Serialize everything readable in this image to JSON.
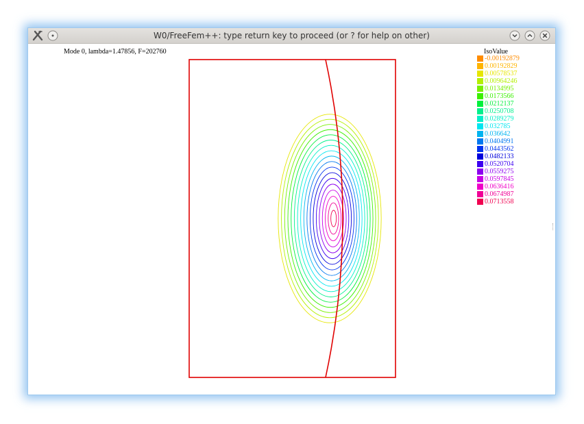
{
  "window": {
    "title": "W0/FreeFem++: type return key to proceed (or ? for help on other)"
  },
  "titlebar": {
    "icons": {
      "app": "freefem-app-icon",
      "menu": "window-menu-icon",
      "minimize": "minimize-icon",
      "maximize": "maximize-icon",
      "close": "close-icon"
    }
  },
  "plot": {
    "label": "Mode 0, lambda=1.47856, F=202760",
    "frame_color": "#e00000"
  },
  "legend": {
    "title": "IsoValue",
    "items": [
      {
        "label": "-0.00192879",
        "color": "#ff8c00"
      },
      {
        "label": "0.00192829",
        "color": "#ffb400"
      },
      {
        "label": "0.00578537",
        "color": "#e6e600"
      },
      {
        "label": "0.00964246",
        "color": "#b4f000"
      },
      {
        "label": "0.0134995",
        "color": "#78f000"
      },
      {
        "label": "0.0173566",
        "color": "#3cf000"
      },
      {
        "label": "0.0212137",
        "color": "#00f03c"
      },
      {
        "label": "0.0250708",
        "color": "#00f08c"
      },
      {
        "label": "0.0289279",
        "color": "#00f0c8"
      },
      {
        "label": "0.032785",
        "color": "#00e6f0"
      },
      {
        "label": "0.036642",
        "color": "#00b4f0"
      },
      {
        "label": "0.0404991",
        "color": "#0078f0"
      },
      {
        "label": "0.0443562",
        "color": "#0032f0"
      },
      {
        "label": "0.0482133",
        "color": "#0000dc"
      },
      {
        "label": "0.0520704",
        "color": "#3c00f0"
      },
      {
        "label": "0.0559275",
        "color": "#8c00f0"
      },
      {
        "label": "0.0597845",
        "color": "#c800e6"
      },
      {
        "label": "0.0636416",
        "color": "#f000c8"
      },
      {
        "label": "0.0674987",
        "color": "#f00096"
      },
      {
        "label": "0.0713558",
        "color": "#f00050"
      }
    ]
  }
}
